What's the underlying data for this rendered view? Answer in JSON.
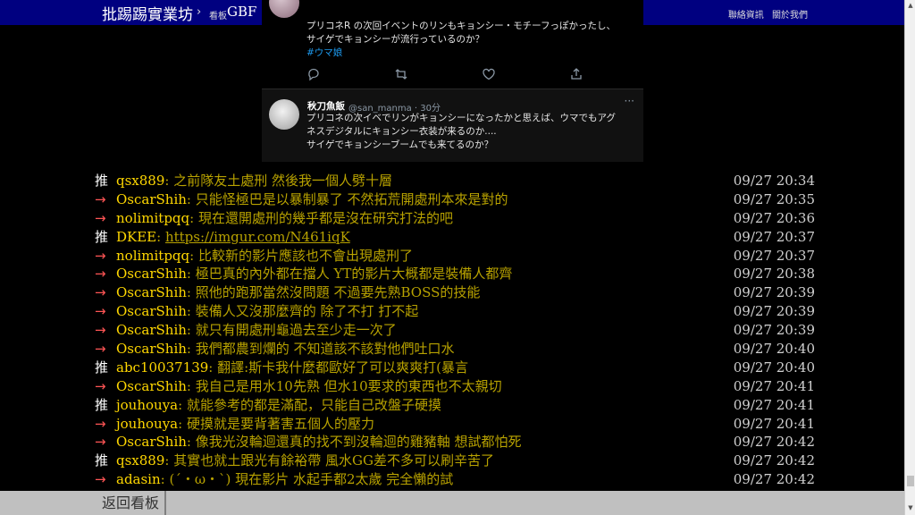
{
  "topbar": {
    "site_name": "批踢踢實業坊",
    "separator": "›",
    "board_label": "看板",
    "board_name": "GBF",
    "nav_contact": "聯絡資訊",
    "nav_about": "關於我們"
  },
  "tweet1": {
    "line1": "プリコネR の次回イベントのリンもキョンシー・モチーフっぽかったし、",
    "line2": "サイゲでキョンシーが流行っているのか？",
    "hashtag": "#ウマ娘"
  },
  "tweet2": {
    "name": "秋刀魚飯",
    "handle": "@san_manma · 30分",
    "more": "···",
    "line1": "プリコネの次イベでリンがキョンシーになったかと思えば、ウマでもアグ",
    "line2": "ネスデジタルにキョンシー衣装が来るのか....",
    "line3": "サイゲでキョンシーブームでも来てるのか？"
  },
  "pushes": [
    {
      "tag": "推",
      "user": "qsx889",
      "content": ": 之前隊友土處刑 然後我一個人劈十層",
      "time": "09/27 20:34"
    },
    {
      "tag": "→",
      "user": "OscarShih",
      "content": ": 只能怪極巴是以暴制暴了 不然拓荒開處刑本來是對的",
      "time": "09/27 20:35"
    },
    {
      "tag": "→",
      "user": "nolimitpqq",
      "content": ": 現在還開處刑的幾乎都是沒在研究打法的吧",
      "time": "09/27 20:36"
    },
    {
      "tag": "推",
      "user": "DKEE",
      "content": ": ",
      "link": "https://imgur.com/N461iqK",
      "time": "09/27 20:37"
    },
    {
      "tag": "→",
      "user": "nolimitpqq",
      "content": ": 比較新的影片應該也不會出現處刑了",
      "time": "09/27 20:37"
    },
    {
      "tag": "→",
      "user": "OscarShih",
      "content": ": 極巴真的內外都在擋人 YT的影片大概都是裝備人都齊",
      "time": "09/27 20:38"
    },
    {
      "tag": "→",
      "user": "OscarShih",
      "content": ": 照他的跑那當然沒問題 不過要先熟BOSS的技能",
      "time": "09/27 20:39"
    },
    {
      "tag": "→",
      "user": "OscarShih",
      "content": ": 裝備人又沒那麼齊的 除了不打 打不起",
      "time": "09/27 20:39"
    },
    {
      "tag": "→",
      "user": "OscarShih",
      "content": ": 就只有開處刑龜過去至少走一次了",
      "time": "09/27 20:39"
    },
    {
      "tag": "→",
      "user": "OscarShih",
      "content": ": 我們都農到爛的 不知道該不該對他們吐口水",
      "time": "09/27 20:40"
    },
    {
      "tag": "推",
      "user": "abc10037139",
      "content": ": 翻譯:斯卡我什麼都歐好了可以爽爽打(暴言",
      "time": "09/27 20:40"
    },
    {
      "tag": "→",
      "user": "OscarShih",
      "content": ": 我自己是用水10先熟 但水10要求的東西也不太親切",
      "time": "09/27 20:41"
    },
    {
      "tag": "推",
      "user": "jouhouya",
      "content": ": 就能參考的都是滿配，只能自己改盤子硬摸",
      "time": "09/27 20:41"
    },
    {
      "tag": "→",
      "user": "jouhouya",
      "content": ": 硬摸就是要背著害五個人的壓力",
      "time": "09/27 20:41"
    },
    {
      "tag": "→",
      "user": "OscarShih",
      "content": ": 像我光沒輪迴還真的找不到沒輪迴的雞豬軸 想試都怕死",
      "time": "09/27 20:42"
    },
    {
      "tag": "推",
      "user": "qsx889",
      "content": ": 其實也就土跟光有餘裕帶 風水GG差不多可以刷辛苦了",
      "time": "09/27 20:42"
    },
    {
      "tag": "→",
      "user": "adasin",
      "content": ": (´・ω・`) 現在影片 水起手都2太歲 完全懶的試",
      "time": "09/27 20:42"
    }
  ],
  "bottombar": {
    "back_label": "返回看板"
  }
}
